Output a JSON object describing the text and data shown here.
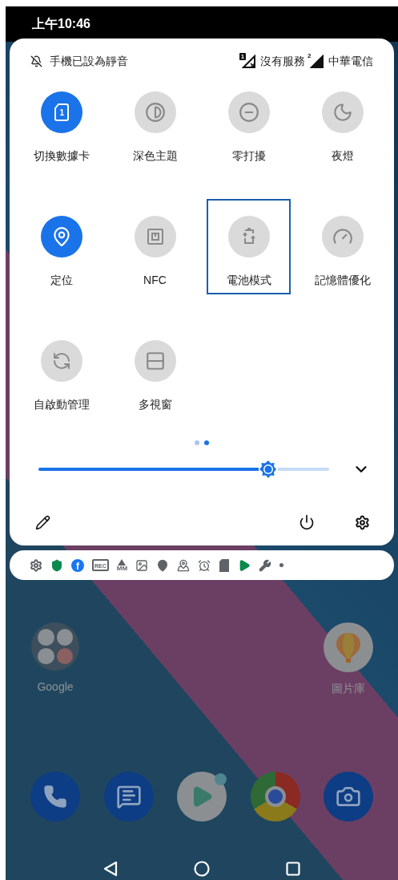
{
  "status_bar": {
    "time": "上午10:46"
  },
  "quick_settings": {
    "header": {
      "ringer": "手機已設為靜音",
      "sims": [
        {
          "kind": "no-service",
          "badge": "1",
          "text": "沒有服務"
        },
        {
          "kind": "signal",
          "badge": "2",
          "text": "中華電信"
        }
      ]
    },
    "tiles": [
      {
        "label": "切換數據卡",
        "on": true,
        "focused": false,
        "badge": "1"
      },
      {
        "label": "深色主題",
        "on": false,
        "focused": false
      },
      {
        "label": "零打擾",
        "on": false,
        "focused": false
      },
      {
        "label": "夜燈",
        "on": false,
        "focused": false
      },
      {
        "label": "定位",
        "on": true,
        "focused": false
      },
      {
        "label": "NFC",
        "on": false,
        "focused": false
      },
      {
        "label": "電池模式",
        "on": false,
        "focused": true
      },
      {
        "label": "記憶體優化",
        "on": false,
        "focused": false
      },
      {
        "label": "自啟動管理",
        "on": false,
        "focused": false
      },
      {
        "label": "多視窗",
        "on": false,
        "focused": false
      }
    ],
    "pages": [
      {
        "selected": false
      },
      {
        "selected": true
      }
    ],
    "brightness": {
      "level": 0.79
    }
  },
  "notification_icons": [
    {
      "kind": "gear"
    },
    {
      "kind": "shield"
    },
    {
      "kind": "facebook",
      "text": "f"
    },
    {
      "kind": "rec",
      "text": "REC"
    },
    {
      "kind": "mm",
      "text": "MM"
    },
    {
      "kind": "image"
    },
    {
      "kind": "pin"
    },
    {
      "kind": "pin-line"
    },
    {
      "kind": "alarm"
    },
    {
      "kind": "sd"
    },
    {
      "kind": "play"
    },
    {
      "kind": "wrench"
    },
    {
      "kind": "dot"
    }
  ],
  "home": {
    "apps": [
      {
        "kind": "folder",
        "label": "Google"
      },
      {
        "kind": "gallery",
        "label": "圖片庫"
      }
    ]
  }
}
